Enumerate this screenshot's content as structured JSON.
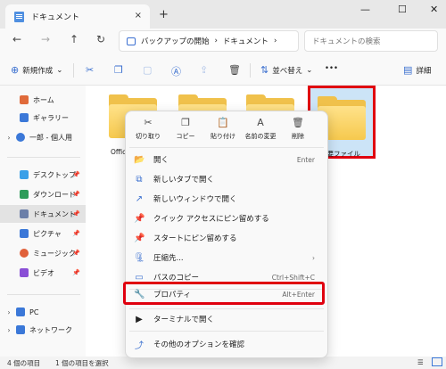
{
  "tab": {
    "title": "ドキュメント",
    "close": "×",
    "new_tab": "+"
  },
  "window": {
    "minimize": "—",
    "maximize": "☐",
    "close": "✕"
  },
  "nav": {
    "back": "←",
    "forward": "→",
    "up": "↑",
    "refresh": "↻",
    "breadcrumb": [
      "バックアップの開始",
      "ドキュメント"
    ],
    "chevron": "›",
    "search_placeholder": "ドキュメントの検索"
  },
  "toolbar": {
    "new_label": "新規作成",
    "sort_label": "並べ替え",
    "more_label": "•••",
    "details_label": "詳細"
  },
  "sidebar": {
    "items": [
      {
        "label": "ホーム",
        "icon": "home-icon",
        "color": "#e06a3a"
      },
      {
        "label": "ギャラリー",
        "icon": "gallery-icon",
        "color": "#3b78d8"
      },
      {
        "label": "一郎 - 個人用",
        "icon": "cloud-icon",
        "color": "#3b78d8"
      },
      {
        "label": "デスクトップ",
        "icon": "desktop-icon",
        "color": "#3aa0e8"
      },
      {
        "label": "ダウンロード",
        "icon": "download-icon",
        "color": "#2e9c5a"
      },
      {
        "label": "ドキュメント",
        "icon": "documents-icon",
        "color": "#6b7fa8"
      },
      {
        "label": "ピクチャ",
        "icon": "pictures-icon",
        "color": "#3b78d8"
      },
      {
        "label": "ミュージック",
        "icon": "music-icon",
        "color": "#e0603a"
      },
      {
        "label": "ビデオ",
        "icon": "video-icon",
        "color": "#8a4fd6"
      },
      {
        "label": "PC",
        "icon": "pc-icon",
        "color": "#3b78d8"
      },
      {
        "label": "ネットワーク",
        "icon": "network-icon",
        "color": "#3b78d8"
      }
    ]
  },
  "folders": [
    {
      "label": "Offic"
    },
    {
      "label": ""
    },
    {
      "label": ""
    },
    {
      "label": "重要ファイル"
    }
  ],
  "status": {
    "count": "4 個の項目",
    "selected": "1 個の項目を選択"
  },
  "context_menu": {
    "quick_actions": [
      {
        "label": "切り取り",
        "icon": "cut-icon",
        "glyph": "✂"
      },
      {
        "label": "コピー",
        "icon": "copy-icon",
        "glyph": "❐"
      },
      {
        "label": "貼り付け",
        "icon": "paste-icon",
        "glyph": "📋"
      },
      {
        "label": "名前の変更",
        "icon": "rename-icon",
        "glyph": "A"
      },
      {
        "label": "削除",
        "icon": "delete-icon",
        "glyph": "🗑"
      }
    ],
    "items": [
      {
        "label": "開く",
        "shortcut": "Enter",
        "glyph": "📂"
      },
      {
        "label": "新しいタブで開く",
        "shortcut": "",
        "glyph": "⧉"
      },
      {
        "label": "新しいウィンドウで開く",
        "shortcut": "",
        "glyph": "↗"
      },
      {
        "label": "クイック アクセスにピン留めする",
        "shortcut": "",
        "glyph": "📌"
      },
      {
        "label": "スタートにピン留めする",
        "shortcut": "",
        "glyph": "📌"
      },
      {
        "label": "圧縮先...",
        "shortcut": "›",
        "glyph": "🗜"
      },
      {
        "label": "パスのコピー",
        "shortcut": "Ctrl+Shift+C",
        "glyph": "▭"
      },
      {
        "label": "プロパティ",
        "shortcut": "Alt+Enter",
        "glyph": "🔧"
      },
      {
        "label": "ターミナルで開く",
        "shortcut": "",
        "glyph": "▶"
      },
      {
        "label": "その他のオプションを確認",
        "shortcut": "",
        "glyph": "⤴"
      }
    ]
  }
}
